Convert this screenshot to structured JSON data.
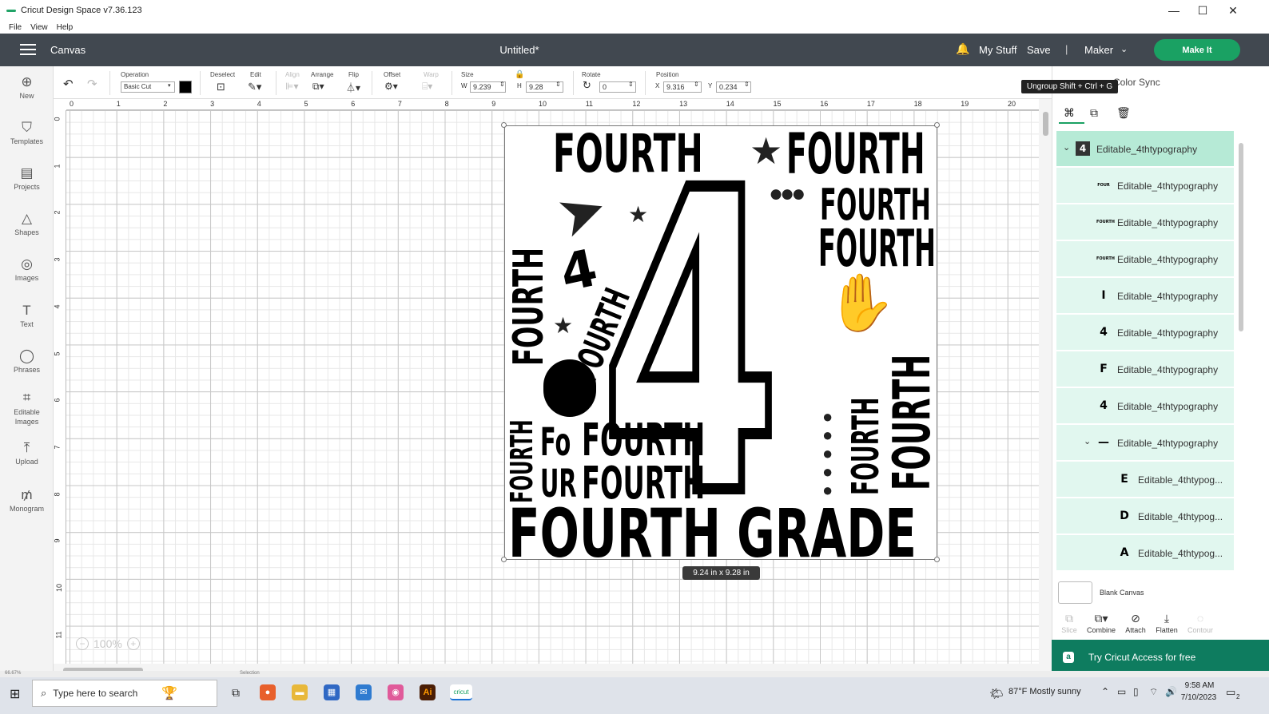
{
  "window": {
    "title": "Cricut Design Space  v7.36.123",
    "minimize": "—",
    "maximize": "☐",
    "close": "✕"
  },
  "menubar": {
    "items": [
      "File",
      "View",
      "Help"
    ]
  },
  "header": {
    "section": "Canvas",
    "doc_title": "Untitled*",
    "my_stuff": "My Stuff",
    "save": "Save",
    "separator": "|",
    "machine": "Maker",
    "make_it": "Make It"
  },
  "leftbar": {
    "items": [
      {
        "label": "New",
        "icon": "⊕"
      },
      {
        "label": "Templates",
        "icon": "👕"
      },
      {
        "label": "Projects",
        "icon": "▤"
      },
      {
        "label": "Shapes",
        "icon": "△"
      },
      {
        "label": "Images",
        "icon": "💡"
      },
      {
        "label": "Text",
        "icon": "T"
      },
      {
        "label": "Phrases",
        "icon": "💬"
      },
      {
        "label": "Editable Images",
        "icon": "⌗"
      },
      {
        "label": "Upload",
        "icon": "⤒"
      },
      {
        "label": "Monogram",
        "icon": "₥"
      }
    ]
  },
  "toolbar": {
    "operation_label": "Operation",
    "operation_value": "Basic Cut",
    "deselect_label": "Deselect",
    "edit_label": "Edit",
    "align_label": "Align",
    "arrange_label": "Arrange",
    "flip_label": "Flip",
    "offset_label": "Offset",
    "warp_label": "Warp",
    "size_label": "Size",
    "w_label": "W",
    "w_value": "9.239",
    "h_label": "H",
    "h_value": "9.28",
    "rotate_label": "Rotate",
    "rotate_value": "0",
    "position_label": "Position",
    "x_label": "X",
    "x_value": "9.316",
    "y_label": "Y",
    "y_value": "0.234",
    "accent_color": "#000000"
  },
  "canvas": {
    "ruler_top": [
      "0",
      "1",
      "2",
      "3",
      "4",
      "5",
      "6",
      "7",
      "8",
      "9",
      "10",
      "11",
      "12",
      "13",
      "14",
      "15",
      "16",
      "17",
      "18",
      "19",
      "20"
    ],
    "ruler_left": [
      "0",
      "1",
      "2",
      "3",
      "4",
      "5",
      "6",
      "7",
      "8",
      "9",
      "10",
      "11"
    ],
    "zoom": "100%",
    "size_tooltip": "9.24  in x 9.28  in",
    "design": {
      "words": [
        "FOURTH",
        "FOURTH",
        "FOURTH",
        "FOURTH",
        "FOURTH",
        "FOURTH",
        "FOURTH",
        "FOURTH",
        "4",
        "FOURTH",
        "Fo",
        "FOURTH",
        "UR",
        "FOURTH",
        "FOURTH",
        "FOURTH",
        "FOURTH GRADE",
        "4"
      ]
    }
  },
  "rightpanel": {
    "tooltip": "Ungroup Shift + Ctrl + G",
    "color_sync": "Color Sync",
    "layers": [
      {
        "name": "Editable_4thtypography",
        "thumb": "4",
        "expanded": true
      },
      {
        "name": "Editable_4thtypography",
        "thumb": "FOUR"
      },
      {
        "name": "Editable_4thtypography",
        "thumb": "FOURTH"
      },
      {
        "name": "Editable_4thtypography",
        "thumb": "FOURTH"
      },
      {
        "name": "Editable_4thtypography",
        "thumb": "I"
      },
      {
        "name": "Editable_4thtypography",
        "thumb": "4"
      },
      {
        "name": "Editable_4thtypography",
        "thumb": "F"
      },
      {
        "name": "Editable_4thtypography",
        "thumb": "4"
      },
      {
        "name": "Editable_4thtypography",
        "thumb": "—",
        "expanded": true
      },
      {
        "name": "Editable_4thtypog...",
        "thumb": "E"
      },
      {
        "name": "Editable_4thtypog...",
        "thumb": "D"
      },
      {
        "name": "Editable_4thtypog...",
        "thumb": "A"
      }
    ],
    "blank_canvas": "Blank Canvas",
    "bottom_tools": [
      {
        "label": "Slice",
        "icon": "⧉",
        "enabled": false
      },
      {
        "label": "Combine",
        "icon": "⧉▾",
        "enabled": true
      },
      {
        "label": "Attach",
        "icon": "⊘",
        "enabled": true
      },
      {
        "label": "Flatten",
        "icon": "⤓",
        "enabled": true
      },
      {
        "label": "Contour",
        "icon": "◌",
        "enabled": false
      }
    ],
    "access_banner": "Try Cricut Access for free"
  },
  "statusbar": {
    "zoom": "66.67%",
    "selection": "Selection"
  },
  "taskbar": {
    "search_placeholder": "Type here to search",
    "weather": "87°F  Mostly sunny",
    "time": "9:58 AM",
    "date": "7/10/2023",
    "notifications": "2"
  }
}
